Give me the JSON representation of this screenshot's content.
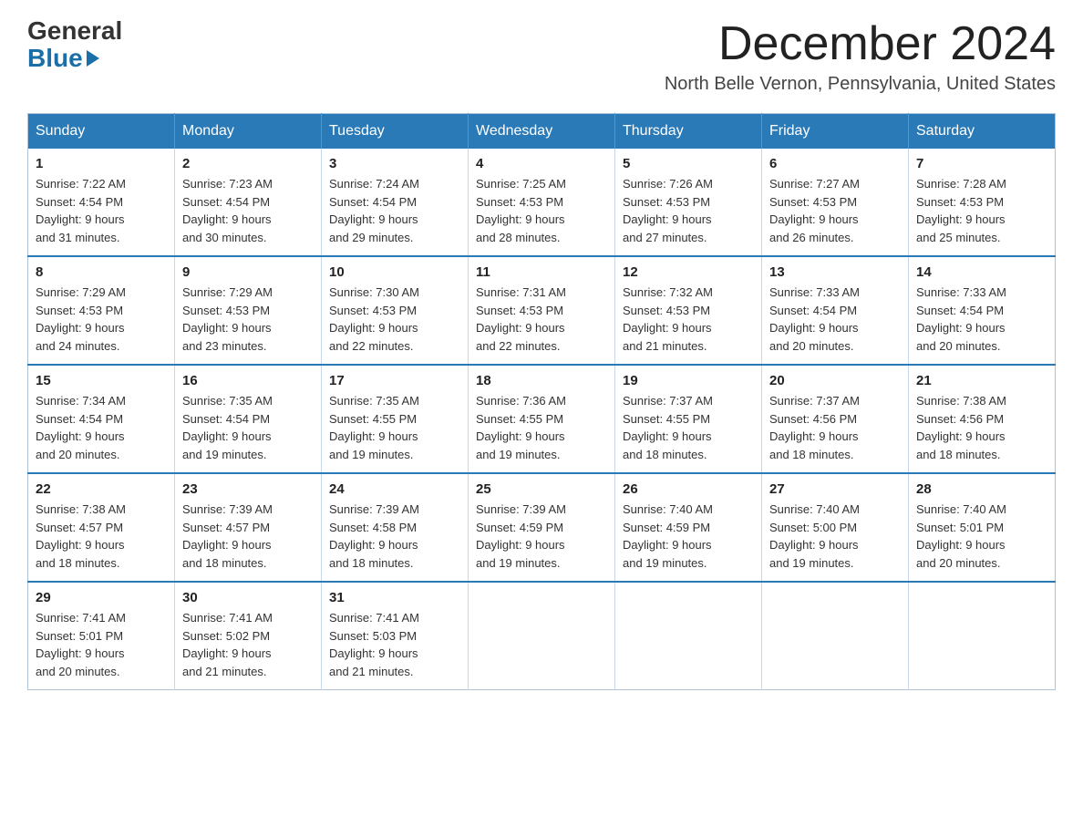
{
  "logo": {
    "general": "General",
    "blue": "Blue"
  },
  "title": "December 2024",
  "location": "North Belle Vernon, Pennsylvania, United States",
  "days_of_week": [
    "Sunday",
    "Monday",
    "Tuesday",
    "Wednesday",
    "Thursday",
    "Friday",
    "Saturday"
  ],
  "weeks": [
    [
      {
        "day": "1",
        "sunrise": "7:22 AM",
        "sunset": "4:54 PM",
        "daylight": "9 hours and 31 minutes."
      },
      {
        "day": "2",
        "sunrise": "7:23 AM",
        "sunset": "4:54 PM",
        "daylight": "9 hours and 30 minutes."
      },
      {
        "day": "3",
        "sunrise": "7:24 AM",
        "sunset": "4:54 PM",
        "daylight": "9 hours and 29 minutes."
      },
      {
        "day": "4",
        "sunrise": "7:25 AM",
        "sunset": "4:53 PM",
        "daylight": "9 hours and 28 minutes."
      },
      {
        "day": "5",
        "sunrise": "7:26 AM",
        "sunset": "4:53 PM",
        "daylight": "9 hours and 27 minutes."
      },
      {
        "day": "6",
        "sunrise": "7:27 AM",
        "sunset": "4:53 PM",
        "daylight": "9 hours and 26 minutes."
      },
      {
        "day": "7",
        "sunrise": "7:28 AM",
        "sunset": "4:53 PM",
        "daylight": "9 hours and 25 minutes."
      }
    ],
    [
      {
        "day": "8",
        "sunrise": "7:29 AM",
        "sunset": "4:53 PM",
        "daylight": "9 hours and 24 minutes."
      },
      {
        "day": "9",
        "sunrise": "7:29 AM",
        "sunset": "4:53 PM",
        "daylight": "9 hours and 23 minutes."
      },
      {
        "day": "10",
        "sunrise": "7:30 AM",
        "sunset": "4:53 PM",
        "daylight": "9 hours and 22 minutes."
      },
      {
        "day": "11",
        "sunrise": "7:31 AM",
        "sunset": "4:53 PM",
        "daylight": "9 hours and 22 minutes."
      },
      {
        "day": "12",
        "sunrise": "7:32 AM",
        "sunset": "4:53 PM",
        "daylight": "9 hours and 21 minutes."
      },
      {
        "day": "13",
        "sunrise": "7:33 AM",
        "sunset": "4:54 PM",
        "daylight": "9 hours and 20 minutes."
      },
      {
        "day": "14",
        "sunrise": "7:33 AM",
        "sunset": "4:54 PM",
        "daylight": "9 hours and 20 minutes."
      }
    ],
    [
      {
        "day": "15",
        "sunrise": "7:34 AM",
        "sunset": "4:54 PM",
        "daylight": "9 hours and 20 minutes."
      },
      {
        "day": "16",
        "sunrise": "7:35 AM",
        "sunset": "4:54 PM",
        "daylight": "9 hours and 19 minutes."
      },
      {
        "day": "17",
        "sunrise": "7:35 AM",
        "sunset": "4:55 PM",
        "daylight": "9 hours and 19 minutes."
      },
      {
        "day": "18",
        "sunrise": "7:36 AM",
        "sunset": "4:55 PM",
        "daylight": "9 hours and 19 minutes."
      },
      {
        "day": "19",
        "sunrise": "7:37 AM",
        "sunset": "4:55 PM",
        "daylight": "9 hours and 18 minutes."
      },
      {
        "day": "20",
        "sunrise": "7:37 AM",
        "sunset": "4:56 PM",
        "daylight": "9 hours and 18 minutes."
      },
      {
        "day": "21",
        "sunrise": "7:38 AM",
        "sunset": "4:56 PM",
        "daylight": "9 hours and 18 minutes."
      }
    ],
    [
      {
        "day": "22",
        "sunrise": "7:38 AM",
        "sunset": "4:57 PM",
        "daylight": "9 hours and 18 minutes."
      },
      {
        "day": "23",
        "sunrise": "7:39 AM",
        "sunset": "4:57 PM",
        "daylight": "9 hours and 18 minutes."
      },
      {
        "day": "24",
        "sunrise": "7:39 AM",
        "sunset": "4:58 PM",
        "daylight": "9 hours and 18 minutes."
      },
      {
        "day": "25",
        "sunrise": "7:39 AM",
        "sunset": "4:59 PM",
        "daylight": "9 hours and 19 minutes."
      },
      {
        "day": "26",
        "sunrise": "7:40 AM",
        "sunset": "4:59 PM",
        "daylight": "9 hours and 19 minutes."
      },
      {
        "day": "27",
        "sunrise": "7:40 AM",
        "sunset": "5:00 PM",
        "daylight": "9 hours and 19 minutes."
      },
      {
        "day": "28",
        "sunrise": "7:40 AM",
        "sunset": "5:01 PM",
        "daylight": "9 hours and 20 minutes."
      }
    ],
    [
      {
        "day": "29",
        "sunrise": "7:41 AM",
        "sunset": "5:01 PM",
        "daylight": "9 hours and 20 minutes."
      },
      {
        "day": "30",
        "sunrise": "7:41 AM",
        "sunset": "5:02 PM",
        "daylight": "9 hours and 21 minutes."
      },
      {
        "day": "31",
        "sunrise": "7:41 AM",
        "sunset": "5:03 PM",
        "daylight": "9 hours and 21 minutes."
      },
      null,
      null,
      null,
      null
    ]
  ],
  "labels": {
    "sunrise": "Sunrise:",
    "sunset": "Sunset:",
    "daylight": "Daylight:"
  }
}
